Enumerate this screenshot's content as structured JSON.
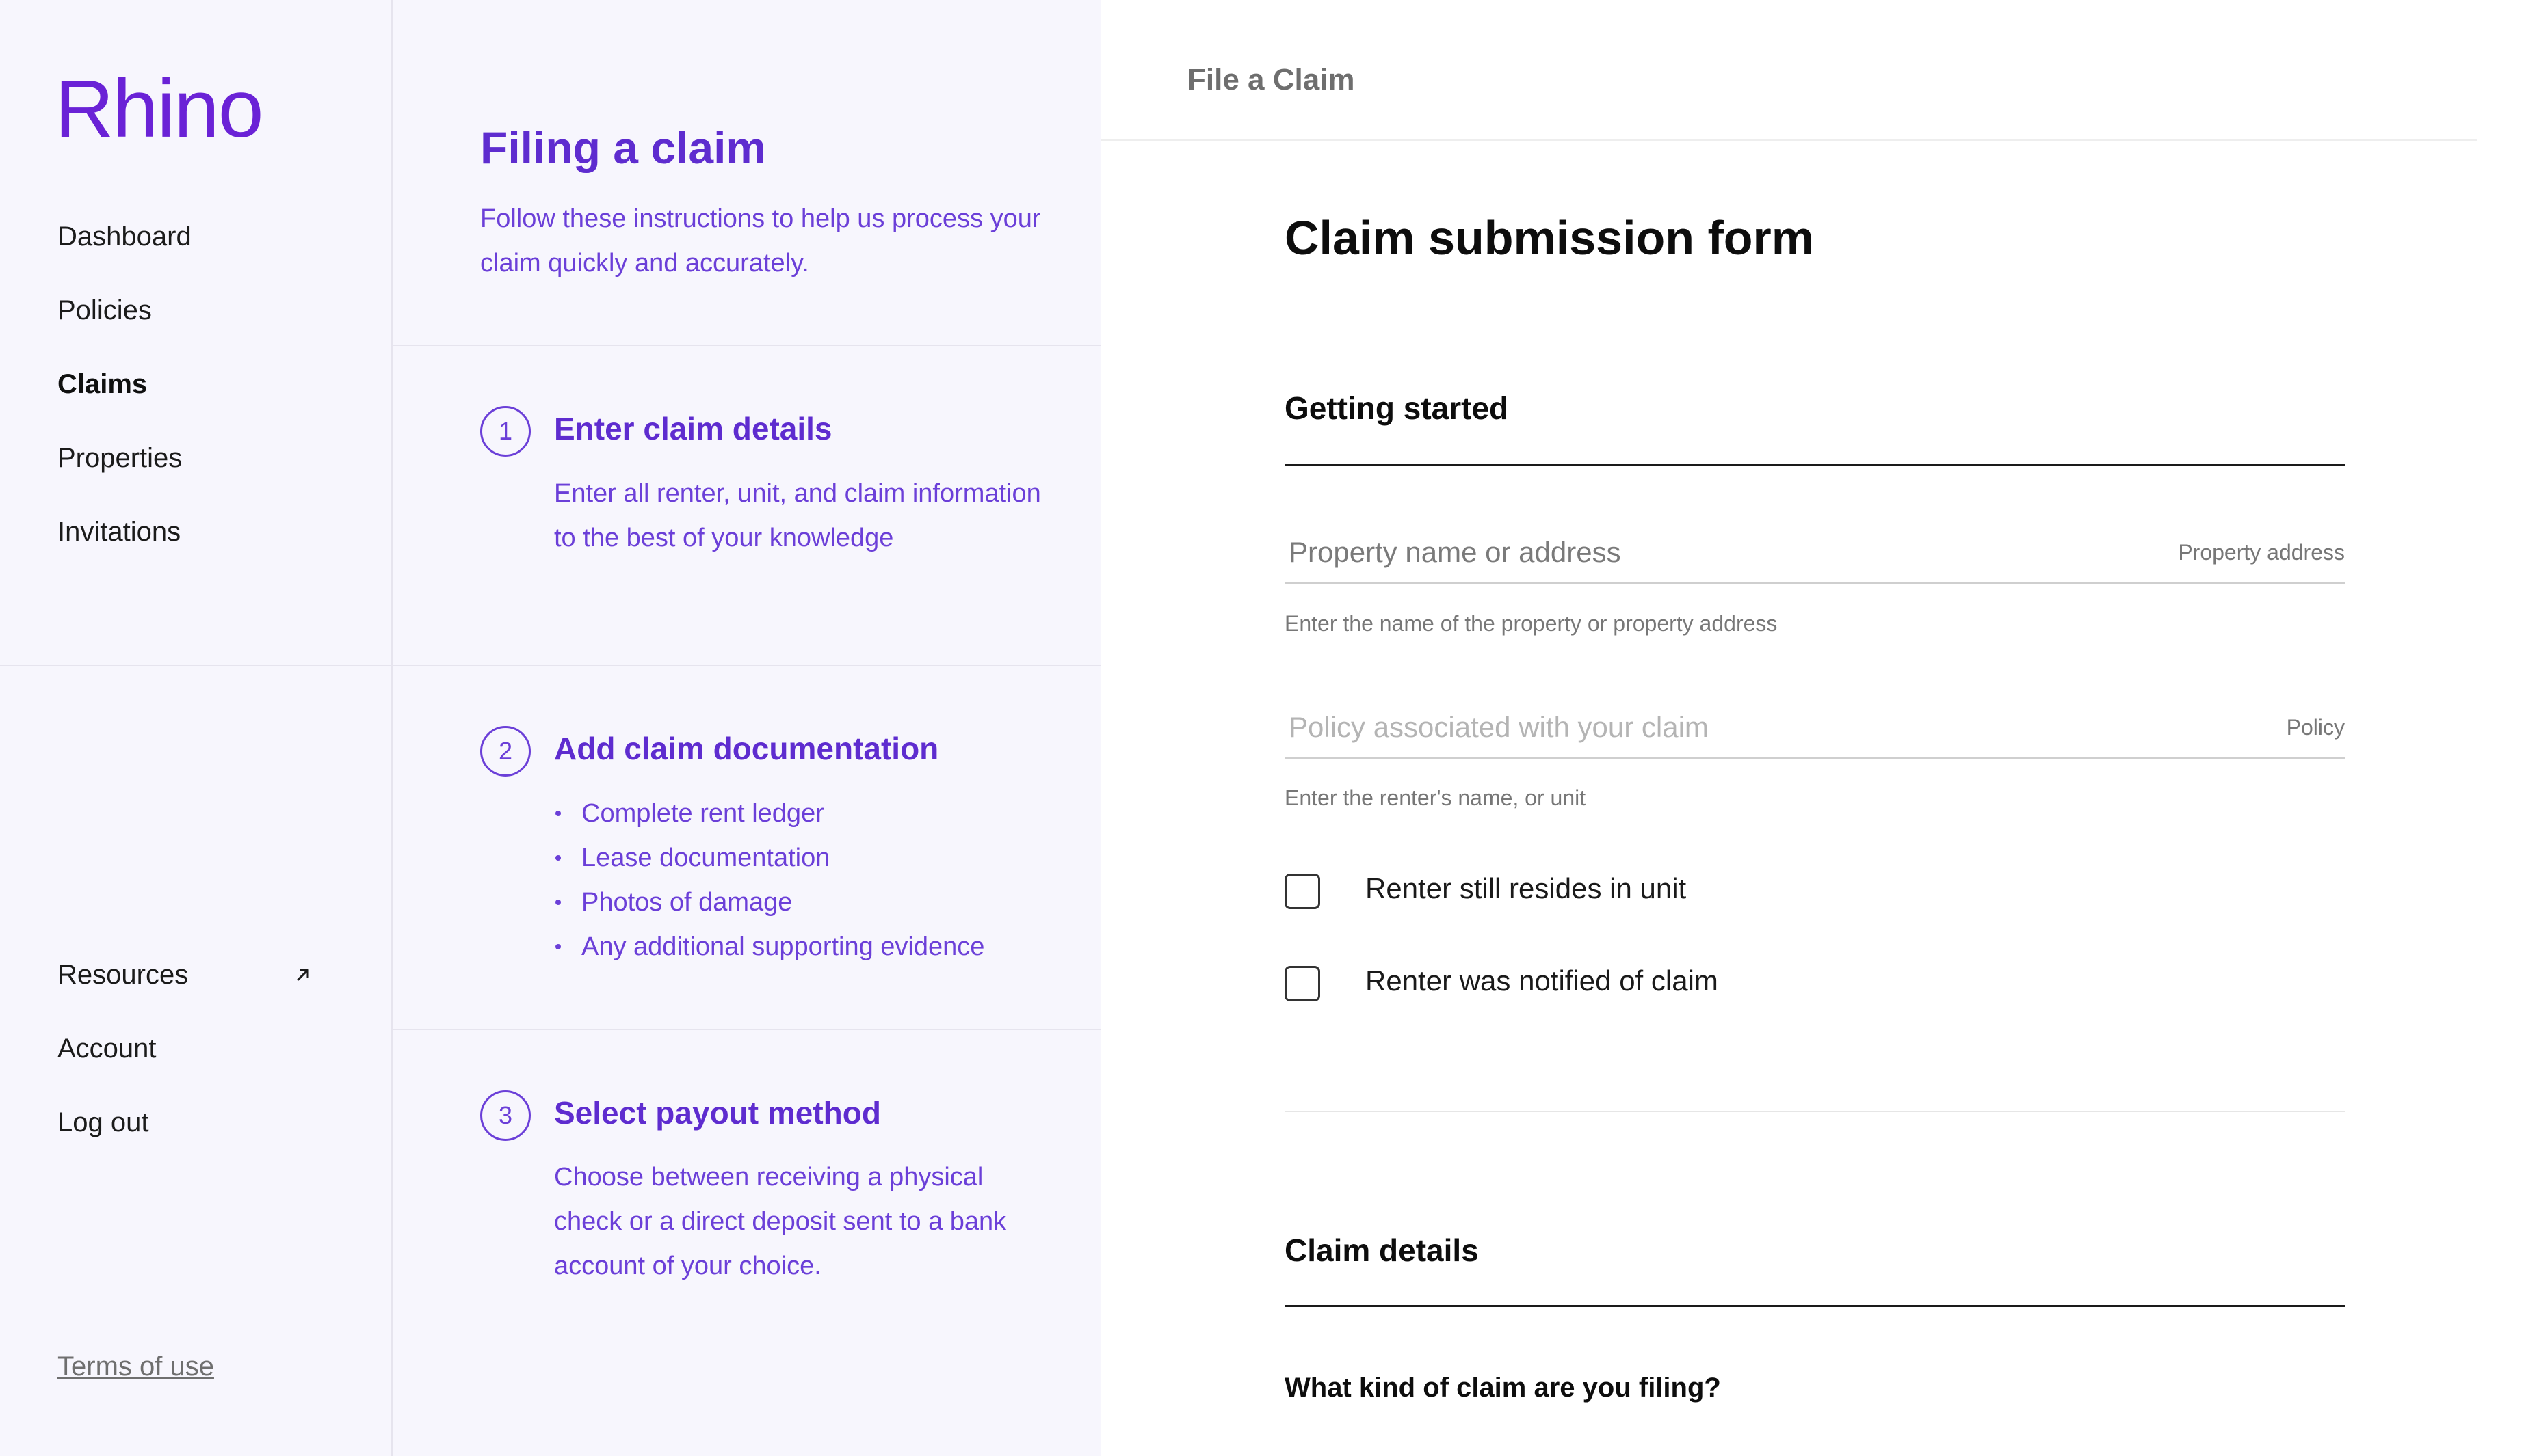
{
  "brand": {
    "name": "Rhino",
    "accent": "#6a22d6"
  },
  "sidebar": {
    "nav": [
      {
        "label": "Dashboard",
        "active": false
      },
      {
        "label": "Policies",
        "active": false
      },
      {
        "label": "Claims",
        "active": true
      },
      {
        "label": "Properties",
        "active": false
      },
      {
        "label": "Invitations",
        "active": false
      }
    ],
    "bottom_nav": [
      {
        "label": "Resources",
        "icon": "external-link-icon"
      },
      {
        "label": "Account"
      },
      {
        "label": "Log out"
      }
    ],
    "terms": "Terms of use"
  },
  "instructions": {
    "title": "Filing a claim",
    "subtitle": "Follow these instructions to help us process your claim quickly and accurately.",
    "steps": [
      {
        "number": "1",
        "title": "Enter claim details",
        "text": "Enter all renter, unit, and claim information to the best of your knowledge"
      },
      {
        "number": "2",
        "title": "Add claim documentation",
        "bullets": [
          "Complete rent ledger",
          "Lease documentation",
          "Photos of damage",
          "Any additional supporting evidence"
        ]
      },
      {
        "number": "3",
        "title": "Select payout method",
        "text": "Choose between receiving a physical check or a direct deposit sent to a bank account of your choice."
      }
    ]
  },
  "main": {
    "topbar_title": "File a Claim",
    "form_title": "Claim submission form",
    "sections": {
      "getting_started": "Getting started",
      "claim_details": "Claim details"
    },
    "fields": [
      {
        "placeholder": "Property name or address",
        "label": "Property address",
        "help": "Enter the name of the property or property address",
        "value": ""
      },
      {
        "placeholder": "Policy associated with your claim",
        "label": "Policy",
        "help": "Enter the renter's name, or unit",
        "value": ""
      }
    ],
    "checkboxes": [
      {
        "label": "Renter still resides in unit",
        "checked": false
      },
      {
        "label": "Renter was notified of claim",
        "checked": false
      }
    ],
    "question": "What kind of claim are you filing?"
  }
}
